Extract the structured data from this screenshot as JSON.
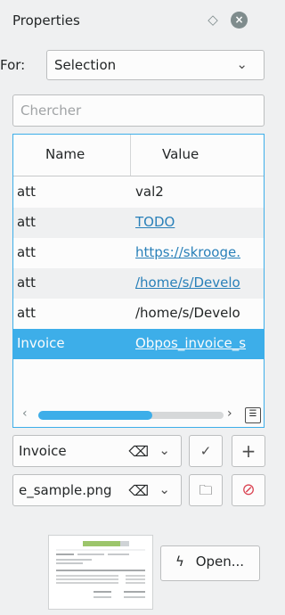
{
  "panel": {
    "title": "Properties"
  },
  "for": {
    "label": "For:",
    "value": "Selection"
  },
  "search": {
    "placeholder": "Chercher"
  },
  "table": {
    "headers": [
      "Name",
      "Value"
    ],
    "rows": [
      {
        "name": "att",
        "value": "val2",
        "link": false
      },
      {
        "name": "att",
        "value": "TODO",
        "link": true
      },
      {
        "name": "att",
        "value": "https://skrooge.",
        "link": true
      },
      {
        "name": "att",
        "value": "/home/s/Develo",
        "link": true
      },
      {
        "name": "att",
        "value": "/home/s/Develo",
        "link": false
      },
      {
        "name": "Invoice",
        "value": "Obpos_invoice_s",
        "link": true
      }
    ]
  },
  "editor": {
    "name_value": "Invoice",
    "value_value": "e_sample.png",
    "open_label": "Open..."
  },
  "colors": {
    "accent": "#3daee9",
    "link": "#2980b9",
    "danger": "#da4453"
  }
}
